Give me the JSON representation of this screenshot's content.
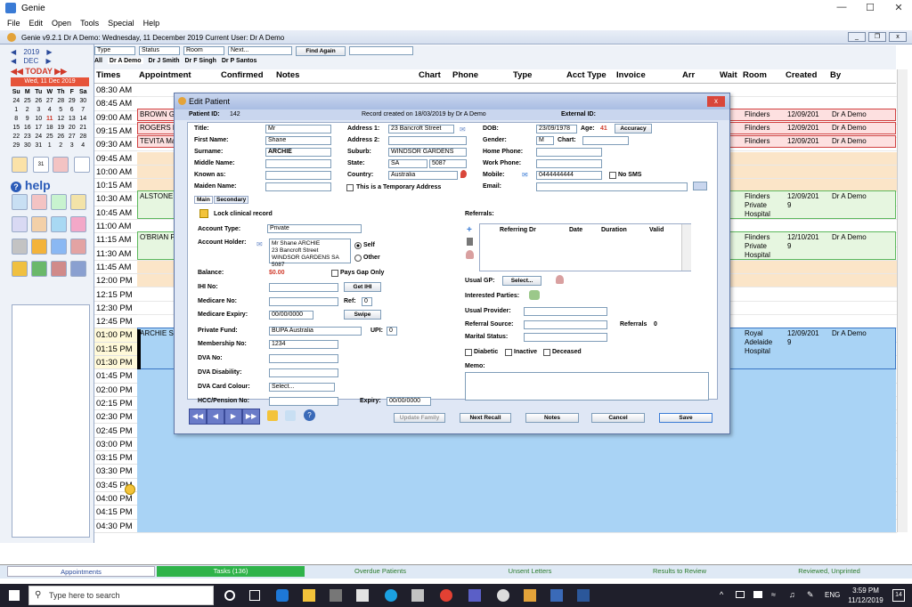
{
  "window": {
    "title": "Genie"
  },
  "menu": [
    "File",
    "Edit",
    "Open",
    "Tools",
    "Special",
    "Help"
  ],
  "appbar": {
    "text": "Genie v9.2.1   Dr A Demo: Wednesday, 11 December 2019   Current User: Dr A Demo"
  },
  "toolbar": {
    "type_label": "Type",
    "status_label": "Status",
    "room_label": "Room",
    "next_label": "Next...",
    "find_again": "Find Again",
    "tabs": [
      "All",
      "Dr A Demo",
      "Dr J Smith",
      "Dr F Singh",
      "Dr P Santos"
    ]
  },
  "calendar": {
    "year": "2019",
    "month": "DEC",
    "today_btn": "TODAY",
    "date_banner": "Wed, 11 Dec 2019",
    "days": [
      "Su",
      "M",
      "Tu",
      "W",
      "Th",
      "F",
      "Sa"
    ],
    "weeks": [
      [
        "24",
        "25",
        "26",
        "27",
        "28",
        "29",
        "30"
      ],
      [
        "1",
        "2",
        "3",
        "4",
        "5",
        "6",
        "7"
      ],
      [
        "8",
        "9",
        "10",
        "11",
        "12",
        "13",
        "14"
      ],
      [
        "15",
        "16",
        "17",
        "18",
        "19",
        "20",
        "21"
      ],
      [
        "22",
        "23",
        "24",
        "25",
        "26",
        "27",
        "28"
      ],
      [
        "29",
        "30",
        "31",
        "1",
        "2",
        "3",
        "4"
      ]
    ],
    "help": "help"
  },
  "columns": [
    "Times",
    "Appointment",
    "Confirmed",
    "Notes",
    "Chart",
    "Phone",
    "Type",
    "Acct Type",
    "Invoice",
    "Arr",
    "Wait",
    "Room",
    "Created",
    "By"
  ],
  "times": [
    "08:30 AM",
    "08:45 AM",
    "09:00 AM",
    "09:15 AM",
    "09:30 AM",
    "09:45 AM",
    "10:00 AM",
    "10:15 AM",
    "10:30 AM",
    "10:45 AM",
    "11:00 AM",
    "11:15 AM",
    "11:30 AM",
    "11:45 AM",
    "12:00 PM",
    "12:15 PM",
    "12:30 PM",
    "12:45 PM",
    "01:00 PM",
    "01:15 PM",
    "01:30 PM",
    "01:45 PM",
    "02:00 PM",
    "02:15 PM",
    "02:30 PM",
    "02:45 PM",
    "03:00 PM",
    "03:15 PM",
    "03:30 PM",
    "03:45 PM",
    "04:00 PM",
    "04:15 PM",
    "04:30 PM"
  ],
  "appointments": [
    {
      "name": "BROWN G",
      "room": "Flinders",
      "created": "12/09/201",
      "by": "Dr A Demo"
    },
    {
      "name": "ROGERS F",
      "room": "Flinders",
      "created": "12/09/201",
      "by": "Dr A Demo"
    },
    {
      "name": "TEVITA Ma",
      "room": "Flinders",
      "created": "12/09/201",
      "by": "Dr A Demo"
    },
    {
      "name": "ALSTONE V",
      "room": "Flinders Private Hospital",
      "created": "12/09/201 9",
      "by": "Dr A Demo"
    },
    {
      "name": "O'BRIAN P \"Paddy\"",
      "room": "Flinders Private Hospital",
      "created": "12/10/201 9",
      "by": "Dr A Demo"
    },
    {
      "name": "ARCHIE SH",
      "room": "Royal Adelaide Hospital",
      "created": "12/09/201 9",
      "by": "Dr A Demo"
    }
  ],
  "dialog": {
    "title": "Edit Patient",
    "patient_id_label": "Patient ID:",
    "patient_id": "142",
    "record_created": "Record created on 18/03/2019 by Dr A Demo",
    "external_id_label": "External ID:",
    "title_label": "Title:",
    "title_val": "Mr",
    "first_name_label": "First Name:",
    "first_name": "Shane",
    "surname_label": "Surname:",
    "surname": "ARCHIE",
    "middle_label": "Middle Name:",
    "known_label": "Known as:",
    "maiden_label": "Maiden Name:",
    "addr1_label": "Address 1:",
    "addr1": "23 Bancroft Street",
    "addr2_label": "Address 2:",
    "suburb_label": "Suburb:",
    "suburb": "WINDSOR GARDENS",
    "state_label": "State:",
    "state": "SA",
    "postcode": "5087",
    "country_label": "Country:",
    "country": "Australia",
    "temp_addr": "This is a Temporary Address",
    "dob_label": "DOB:",
    "dob": "23/09/1978",
    "age_label": "Age:",
    "age": "41",
    "accuracy_btn": "Accuracy",
    "gender_label": "Gender:",
    "gender": "M",
    "chart_label": "Chart:",
    "home_label": "Home Phone:",
    "work_label": "Work Phone:",
    "mobile_label": "Mobile:",
    "mobile": "0444444444",
    "nosms": "No SMS",
    "email_label": "Email:",
    "tabs": [
      "Main",
      "Secondary"
    ],
    "lock": "Lock clinical record",
    "acct_type_label": "Account Type:",
    "acct_type": "Private",
    "acct_holder_label": "Account Holder:",
    "acct_holder": [
      "Mr Shane ARCHIE",
      "23 Bancroft Street",
      "WINDSOR GARDENS SA 5087"
    ],
    "self": "Self",
    "other": "Other",
    "balance_label": "Balance:",
    "balance": "$0.00",
    "pays_gap": "Pays Gap Only",
    "ihi_label": "IHI No:",
    "get_ihi": "Get IHI",
    "medicare_label": "Medicare No:",
    "ref_label": "Ref:",
    "ref": "0",
    "medicare_exp_label": "Medicare Expiry:",
    "medicare_exp": "00/00/0000",
    "swipe": "Swipe",
    "fund_label": "Private Fund:",
    "fund": "BUPA Australia",
    "upi_label": "UPI:",
    "upi": "0",
    "membership_label": "Membership No:",
    "membership": "1234",
    "dva_label": "DVA No:",
    "dva_dis_label": "DVA Disability:",
    "dva_colour_label": "DVA Card Colour:",
    "dva_colour": "Select...",
    "hcc_label": "HCC/Pension No:",
    "expiry_label": "Expiry:",
    "expiry": "00/00/0000",
    "referrals_label": "Referrals:",
    "ref_cols": [
      "Referring Dr",
      "Date",
      "Duration",
      "Valid"
    ],
    "usual_gp_label": "Usual GP:",
    "select_btn": "Select...",
    "interested_label": "Interested Parties:",
    "usual_provider_label": "Usual Provider:",
    "referral_source_label": "Referral Source:",
    "referrals_count_label": "Referrals",
    "referrals_count": "0",
    "marital_label": "Marital Status:",
    "diabetic": "Diabetic",
    "inactive": "Inactive",
    "deceased": "Deceased",
    "memo_label": "Memo:",
    "buttons": {
      "update_family": "Update Family",
      "next_recall": "Next Recall",
      "notes": "Notes",
      "cancel": "Cancel",
      "save": "Save"
    }
  },
  "statusbar": [
    "Appointments",
    "Tasks (136)",
    "Overdue Patients",
    "Unsent Letters",
    "Results to Review",
    "Reviewed, Unprinted"
  ],
  "taskbar": {
    "search": "Type here to search",
    "lang": "ENG",
    "time": "3:59 PM",
    "date": "11/12/2019",
    "notif": "14"
  }
}
